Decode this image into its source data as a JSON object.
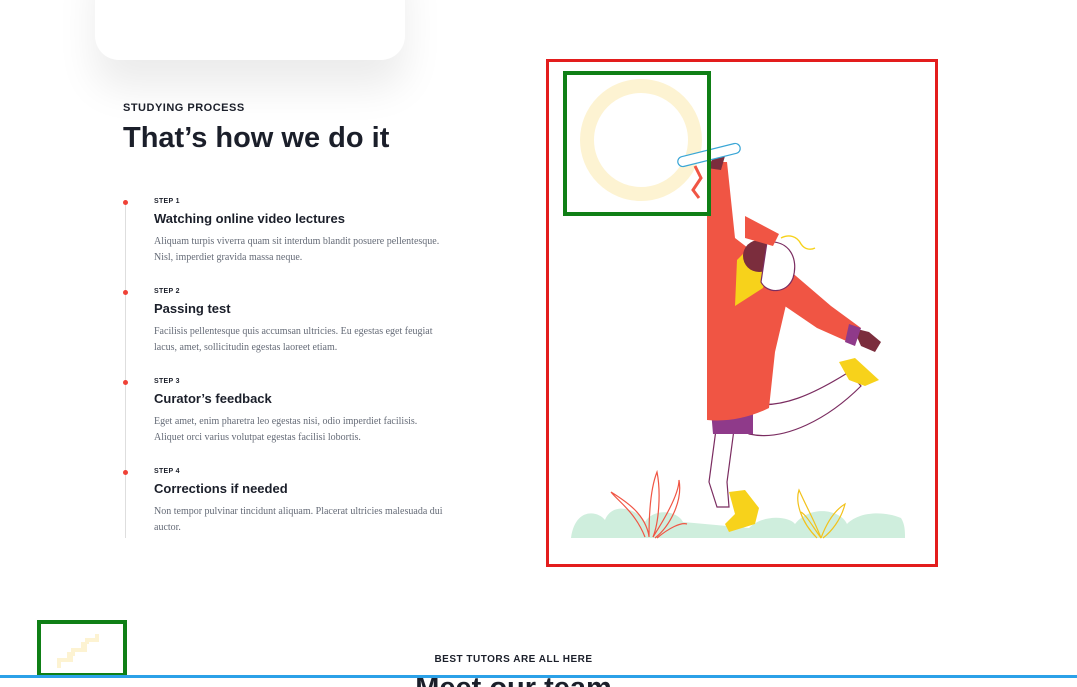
{
  "section": {
    "eyebrow": "STUDYING PROCESS",
    "title": "That’s how we do it"
  },
  "steps": [
    {
      "label": "STEP 1",
      "title": "Watching online video lectures",
      "description": "Aliquam turpis viverra quam sit interdum blandit posuere pellentesque. Nisl, imperdiet gravida massa neque."
    },
    {
      "label": "STEP 2",
      "title": "Passing test",
      "description": "Facilisis pellentesque quis accumsan ultricies. Eu egestas eget feugiat lacus, amet, sollicitudin egestas laoreet etiam."
    },
    {
      "label": "STEP 3",
      "title": "Curator’s feedback",
      "description": "Eget amet, enim pharetra leo egestas nisi, odio imperdiet facilisis. Aliquet orci varius volutpat egestas facilisi lobortis."
    },
    {
      "label": "STEP 4",
      "title": "Corrections if needed",
      "description": "Non tempor pulvinar tincidunt aliquam. Placerat ultricies malesuada dui auctor."
    }
  ],
  "next_section": {
    "eyebrow": "BEST TUTORS ARE ALL HERE",
    "title": "Meet our team"
  },
  "colors": {
    "accent": "#ef4136",
    "illustration_border": "#e31d1d",
    "decor_border": "#0f7f16",
    "bottom_bar": "#2ba1e8",
    "coat": "#f05544",
    "grass": "#cfeedd",
    "yellow": "#f7d21b"
  },
  "icons": {
    "illustration": "graduate-illustration",
    "decor_ring": "yellow-ring-decoration",
    "decor_stairs": "stairs-decoration"
  }
}
